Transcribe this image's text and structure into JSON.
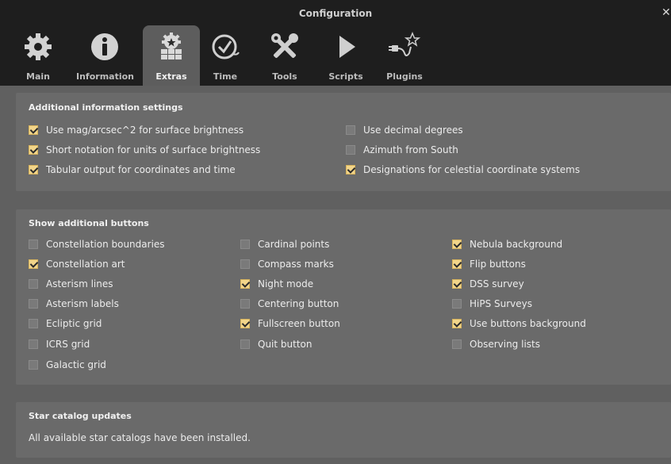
{
  "window": {
    "title": "Configuration",
    "close_icon": "close-icon"
  },
  "tabs": [
    {
      "label": "Main",
      "icon": "gear-icon",
      "active": false
    },
    {
      "label": "Information",
      "icon": "info-icon",
      "active": false
    },
    {
      "label": "Extras",
      "icon": "extras-icon",
      "active": true
    },
    {
      "label": "Time",
      "icon": "clock-icon",
      "active": false
    },
    {
      "label": "Tools",
      "icon": "tools-icon",
      "active": false
    },
    {
      "label": "Scripts",
      "icon": "play-icon",
      "active": false
    },
    {
      "label": "Plugins",
      "icon": "plug-icon",
      "active": false
    }
  ],
  "additional_info": {
    "title": "Additional information settings",
    "left": [
      {
        "label": "Use mag/arcsec^2 for surface brightness",
        "checked": true
      },
      {
        "label": "Short notation for units of surface brightness",
        "checked": true
      },
      {
        "label": "Tabular output for coordinates and time",
        "checked": true
      }
    ],
    "right": [
      {
        "label": "Use decimal degrees",
        "checked": false
      },
      {
        "label": "Azimuth from South",
        "checked": false
      },
      {
        "label": "Designations for celestial coordinate systems",
        "checked": true
      }
    ]
  },
  "buttons": {
    "title": "Show additional buttons",
    "col1": [
      {
        "label": "Constellation boundaries",
        "checked": false
      },
      {
        "label": "Constellation art",
        "checked": true
      },
      {
        "label": "Asterism lines",
        "checked": false
      },
      {
        "label": "Asterism labels",
        "checked": false
      },
      {
        "label": "Ecliptic grid",
        "checked": false
      },
      {
        "label": "ICRS grid",
        "checked": false
      },
      {
        "label": "Galactic grid",
        "checked": false
      }
    ],
    "col2": [
      {
        "label": "Cardinal points",
        "checked": false
      },
      {
        "label": "Compass marks",
        "checked": false
      },
      {
        "label": "Night mode",
        "checked": true
      },
      {
        "label": "Centering button",
        "checked": false
      },
      {
        "label": "Fullscreen button",
        "checked": true
      },
      {
        "label": "Quit button",
        "checked": false
      }
    ],
    "col3": [
      {
        "label": "Nebula background",
        "checked": true
      },
      {
        "label": "Flip buttons",
        "checked": true
      },
      {
        "label": "DSS survey",
        "checked": true
      },
      {
        "label": "HiPS Surveys",
        "checked": false
      },
      {
        "label": "Use buttons background",
        "checked": true
      },
      {
        "label": "Observing lists",
        "checked": false
      }
    ]
  },
  "catalog": {
    "title": "Star catalog updates",
    "status": "All available star catalogs have been installed."
  }
}
